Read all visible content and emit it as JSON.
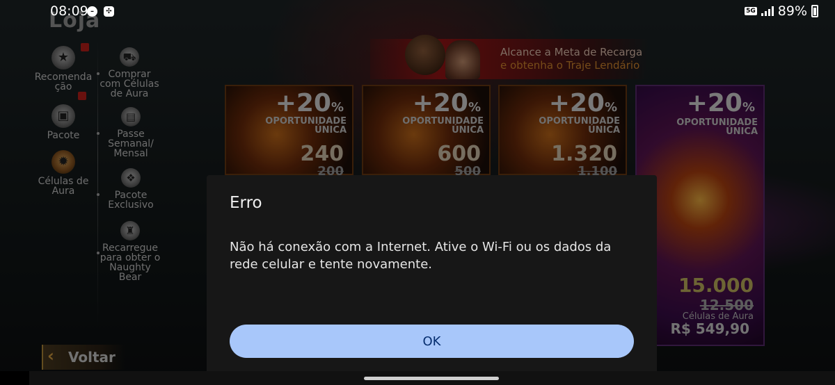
{
  "status_bar": {
    "time": "08:09",
    "network": "5G",
    "battery": "89%",
    "icons": [
      "do-not-disturb-icon",
      "app-notification-icon",
      "signal-icon",
      "battery-icon"
    ]
  },
  "game": {
    "title": "Loja",
    "sidebar_main": [
      {
        "label": "Recomenda ção",
        "icon": "star-badge-icon",
        "badge": true
      },
      {
        "label": "Pacote",
        "icon": "gift-box-icon",
        "badge": true
      },
      {
        "label": "Células de Aura",
        "icon": "aura-cell-icon",
        "active": true
      }
    ],
    "sidebar_sub": [
      {
        "label": "Comprar com Células de Aura",
        "icon": "cart-icon"
      },
      {
        "label": "Passe Semanal/ Mensal",
        "icon": "cards-icon"
      },
      {
        "label": "Pacote Exclusivo",
        "icon": "exclusive-pack-icon"
      },
      {
        "label": "Recarregue para obter o Naughty Bear",
        "icon": "bear-gift-icon"
      }
    ],
    "banner": {
      "line1": "Alcance a Meta de Recarga",
      "line2": "e obtenha o Traje Lendário"
    },
    "cards": [
      {
        "bonus": "+20",
        "bonus_unit": "%",
        "tag_line1": "OPORTUNIDADE",
        "tag_line2": "ÚNICA",
        "amount": "240",
        "old_amount": "200"
      },
      {
        "bonus": "+20",
        "bonus_unit": "%",
        "tag_line1": "OPORTUNIDADE",
        "tag_line2": "ÚNICA",
        "amount": "600",
        "old_amount": "500"
      },
      {
        "bonus": "+20",
        "bonus_unit": "%",
        "tag_line1": "OPORTUNIDADE",
        "tag_line2": "ÚNICA",
        "amount": "1.320",
        "old_amount": "1.100"
      },
      {
        "bonus": "+20",
        "bonus_unit": "%",
        "tag_line1": "OPORTUNIDADE",
        "tag_line2": "ÚNICA",
        "amount": "15.000",
        "old_amount": "12.500",
        "label": "Células de Aura",
        "price": "R$ 549,90"
      }
    ],
    "back_button": {
      "label": "Voltar",
      "icon": "back-arrow-icon"
    }
  },
  "dialog": {
    "title": "Erro",
    "message": "Não há conexão com a Internet. Ative o Wi-Fi ou os dados da rede celular e tente novamente.",
    "ok_label": "OK",
    "ok_color": "#a8c7fa"
  }
}
